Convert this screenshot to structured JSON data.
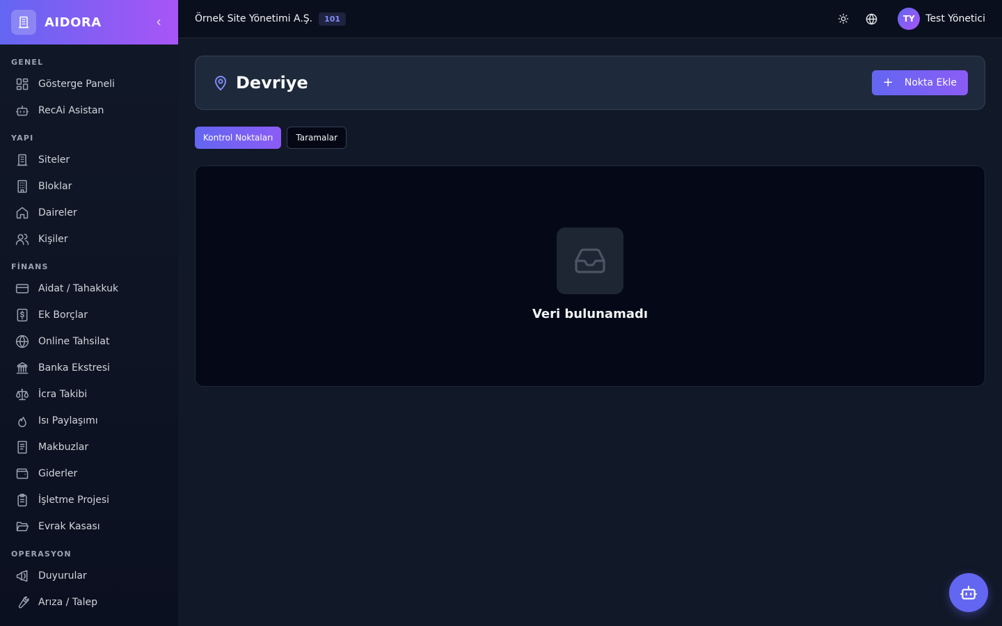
{
  "brand": {
    "name": "AIDORA"
  },
  "header": {
    "org_name": "Örnek Site Yönetimi A.Ş.",
    "org_badge": "101",
    "user_initials": "TY",
    "user_name": "Test Yönetici"
  },
  "sidebar": {
    "sections": [
      {
        "title": "GENEL",
        "items": [
          {
            "label": "Gösterge Paneli",
            "icon": "dashboard-icon"
          },
          {
            "label": "RecAi Asistan",
            "icon": "bot-icon"
          }
        ]
      },
      {
        "title": "YAPI",
        "items": [
          {
            "label": "Siteler",
            "icon": "building-icon"
          },
          {
            "label": "Bloklar",
            "icon": "block-icon"
          },
          {
            "label": "Daireler",
            "icon": "home-icon"
          },
          {
            "label": "Kişiler",
            "icon": "users-icon"
          }
        ]
      },
      {
        "title": "FİNANS",
        "items": [
          {
            "label": "Aidat / Tahakkuk",
            "icon": "credit-card-icon"
          },
          {
            "label": "Ek Borçlar",
            "icon": "dollar-receipt-icon"
          },
          {
            "label": "Online Tahsilat",
            "icon": "globe-icon"
          },
          {
            "label": "Banka Ekstresi",
            "icon": "bank-icon"
          },
          {
            "label": "İcra Takibi",
            "icon": "scale-icon"
          },
          {
            "label": "Isı Paylaşımı",
            "icon": "flame-icon"
          },
          {
            "label": "Makbuzlar",
            "icon": "document-icon"
          },
          {
            "label": "Giderler",
            "icon": "wallet-icon"
          },
          {
            "label": "İşletme Projesi",
            "icon": "clipboard-icon"
          },
          {
            "label": "Evrak Kasası",
            "icon": "folder-open-icon"
          }
        ]
      },
      {
        "title": "OPERASYON",
        "items": [
          {
            "label": "Duyurular",
            "icon": "megaphone-icon"
          },
          {
            "label": "Arıza / Talep",
            "icon": "wrench-icon"
          }
        ]
      }
    ]
  },
  "page": {
    "title": "Devriye",
    "add_button": "Nokta Ekle",
    "tabs": [
      {
        "label": "Kontrol Noktaları",
        "active": true
      },
      {
        "label": "Taramalar",
        "active": false
      }
    ],
    "empty_text": "Veri bulunamadı"
  },
  "colors": {
    "accent": "#6366f1",
    "accent_alt": "#8b5cf6",
    "background": "#111827",
    "card": "#1e293b"
  }
}
